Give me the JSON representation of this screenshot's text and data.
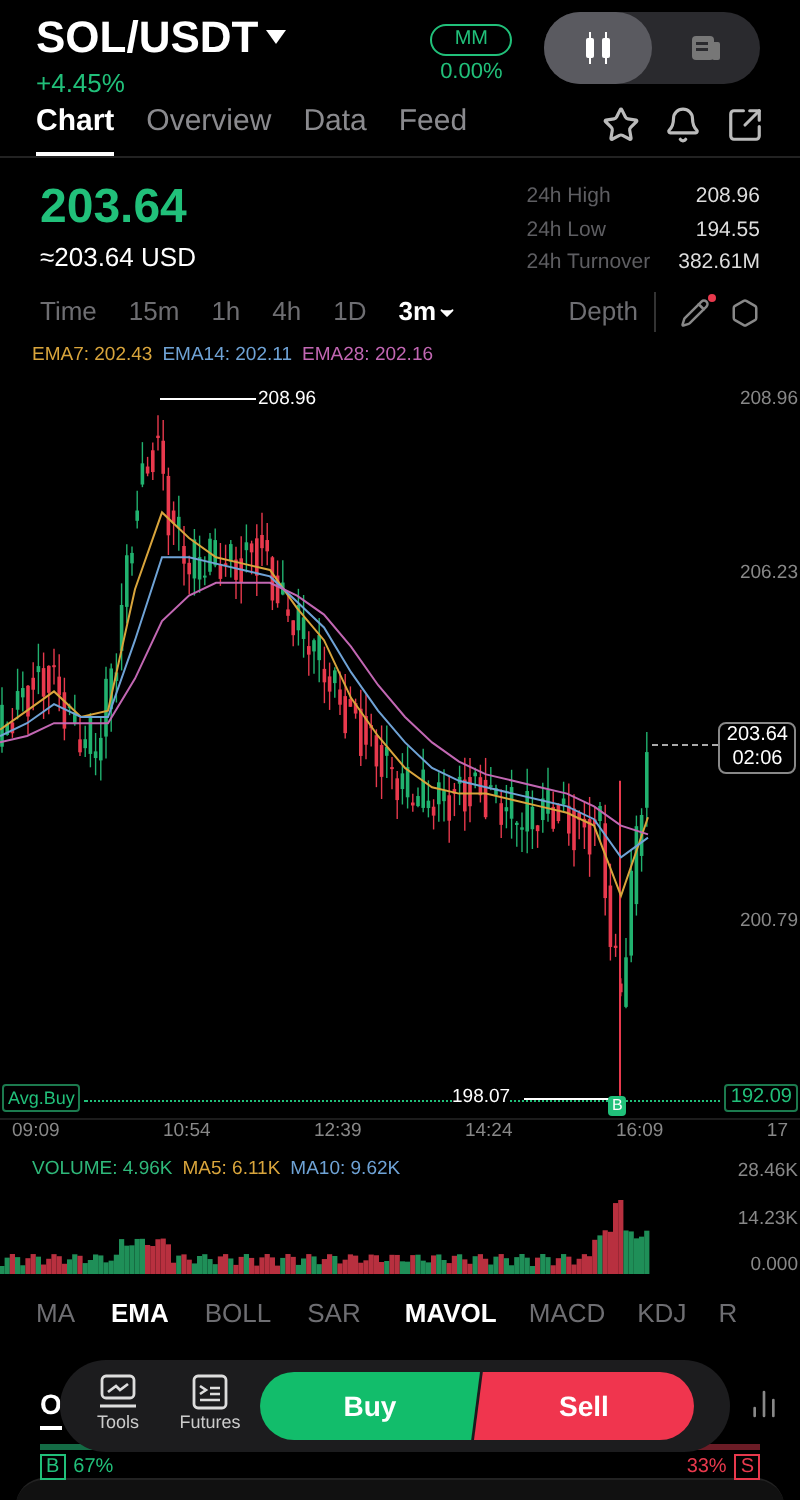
{
  "header": {
    "pair": "SOL/USDT",
    "change": "+4.45%",
    "mm_badge": "MM",
    "mm_value": "0.00%",
    "view_toggle": [
      {
        "kind": "candles",
        "selected": true
      },
      {
        "kind": "info",
        "selected": false
      }
    ]
  },
  "tabs": [
    {
      "label": "Chart",
      "selected": true
    },
    {
      "label": "Overview",
      "selected": false
    },
    {
      "label": "Data",
      "selected": false
    },
    {
      "label": "Feed",
      "selected": false
    }
  ],
  "price": {
    "last": "203.64",
    "usd": "≈203.64 USD"
  },
  "stats": [
    {
      "label": "24h High",
      "value": "208.96"
    },
    {
      "label": "24h Low",
      "value": "194.55"
    },
    {
      "label": "24h Turnover",
      "value": "382.61M"
    }
  ],
  "timeframes": [
    {
      "label": "Time",
      "selected": false,
      "dropdown": false
    },
    {
      "label": "15m",
      "selected": false,
      "dropdown": false
    },
    {
      "label": "1h",
      "selected": false,
      "dropdown": false
    },
    {
      "label": "4h",
      "selected": false,
      "dropdown": false
    },
    {
      "label": "1D",
      "selected": false,
      "dropdown": false
    },
    {
      "label": "3m",
      "selected": true,
      "dropdown": true
    }
  ],
  "depth": "Depth",
  "draw_tool": {
    "notification": true
  },
  "chart": {
    "chart_data": {
      "type": "line",
      "ylim": [
        200.79,
        208.96
      ],
      "yticks": [
        {
          "value": 208.96,
          "label": "208.96"
        },
        {
          "value": 206.23,
          "label": "206.23"
        },
        {
          "value": 200.79,
          "label": "200.79"
        }
      ],
      "series": [
        {
          "name": "EMA7: 202.43",
          "color": "#d9a53c",
          "values": [
            203.8,
            204.1,
            204.4,
            204.0,
            204.1,
            206.0,
            207.2,
            206.8,
            206.5,
            206.4,
            206.3,
            205.7,
            205.2,
            204.3,
            203.7,
            203.2,
            202.9,
            202.8,
            202.8,
            202.7,
            202.6,
            202.5,
            202.3,
            201.2,
            202.43
          ]
        },
        {
          "name": "EMA14: 202.11",
          "color": "#6fa3d6",
          "values": [
            203.7,
            203.9,
            204.2,
            204.0,
            204.0,
            205.2,
            206.5,
            206.5,
            206.4,
            206.3,
            206.2,
            205.8,
            205.4,
            204.7,
            204.1,
            203.6,
            203.2,
            203.0,
            202.9,
            202.8,
            202.7,
            202.6,
            202.4,
            201.8,
            202.11
          ]
        },
        {
          "name": "EMA28: 202.16",
          "color": "#c267b3",
          "values": [
            203.6,
            203.7,
            203.9,
            203.9,
            203.9,
            204.6,
            205.5,
            205.9,
            206.1,
            206.1,
            206.1,
            205.9,
            205.6,
            205.1,
            204.5,
            204.0,
            203.6,
            203.3,
            203.1,
            203.0,
            202.9,
            202.8,
            202.6,
            202.3,
            202.16
          ]
        }
      ]
    },
    "high_marker": "208.96",
    "low_marker": "198.07",
    "last_price": "203.64",
    "countdown": "02:06",
    "avg_buy_label": "Avg.Buy",
    "avg_buy_price": "192.09",
    "trade_marker": "B",
    "x_axis": [
      "09:09",
      "10:54",
      "12:39",
      "14:24",
      "16:09",
      "17"
    ]
  },
  "volume": {
    "legend": [
      {
        "label": "VOLUME: 4.96K",
        "color": "#2fb87a"
      },
      {
        "label": "MA5: 6.11K",
        "color": "#d9a53c"
      },
      {
        "label": "MA10: 9.62K",
        "color": "#6fa3d6"
      }
    ],
    "y_axis": [
      "28.46K",
      "14.23K",
      "0.000"
    ]
  },
  "main_indicators": [
    {
      "label": "MA",
      "selected": false
    },
    {
      "label": "EMA",
      "selected": true
    },
    {
      "label": "BOLL",
      "selected": false
    },
    {
      "label": "SAR",
      "selected": false
    }
  ],
  "sub_indicators": [
    {
      "label": "MAVOL",
      "selected": true
    },
    {
      "label": "MACD",
      "selected": false
    },
    {
      "label": "KDJ",
      "selected": false
    },
    {
      "label": "R",
      "selected": false
    }
  ],
  "action_bar": {
    "tools": [
      {
        "kind": "tools",
        "label": "Tools"
      },
      {
        "kind": "futures",
        "label": "Futures"
      }
    ],
    "buy": "Buy",
    "sell": "Sell"
  },
  "orders": {
    "tab": "O",
    "buy_badge": "B",
    "buy_share": "67%",
    "sell_share": "33%",
    "sell_badge": "S",
    "level": 0.67
  }
}
